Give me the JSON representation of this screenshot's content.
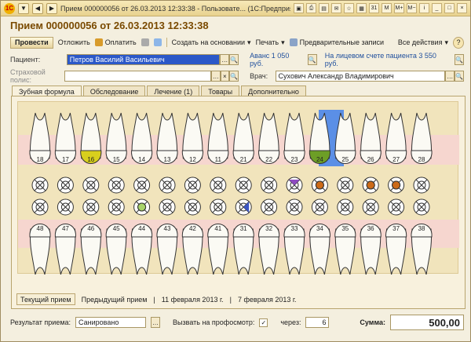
{
  "window": {
    "title": "Прием 000000056 от 26.03.2013 12:33:38 - Пользовате... (1С:Предприятие)"
  },
  "header": {
    "title": "Прием 000000056 от 26.03.2013 12:33:38"
  },
  "toolbar": {
    "post": "Провести",
    "defer": "Отложить",
    "pay": "Оплатить",
    "create_basis": "Создать на основании",
    "print": "Печать",
    "preliminary": "Предварительные записи",
    "all_actions": "Все действия",
    "help": "?"
  },
  "patient": {
    "label": "Пациент:",
    "value": "Петров Василий Васильевич",
    "advance": "Аванс 1 050 руб.",
    "balance": "На лицевом счете пациента 3 550 руб."
  },
  "insurance": {
    "label": "Страховой полис:",
    "value": ""
  },
  "doctor": {
    "label": "Врач:",
    "value": "Сухович Александр Владимирович"
  },
  "tabs": [
    {
      "label": "Зубная формула"
    },
    {
      "label": "Обследование"
    },
    {
      "label": "Лечение (1)"
    },
    {
      "label": "Товары"
    },
    {
      "label": "Дополнительно"
    }
  ],
  "teeth": {
    "upper": [
      "18",
      "17",
      "16",
      "15",
      "14",
      "13",
      "12",
      "11",
      "21",
      "22",
      "23",
      "24",
      "25",
      "26",
      "27",
      "28"
    ],
    "lower": [
      "48",
      "47",
      "46",
      "45",
      "44",
      "43",
      "42",
      "41",
      "31",
      "32",
      "33",
      "34",
      "35",
      "36",
      "37",
      "38"
    ]
  },
  "visits": {
    "current": "Текущий прием",
    "previous": "Предыдущий прием",
    "date1": "11 февраля 2013 г.",
    "date2": "7 февраля 2013 г."
  },
  "footer": {
    "result_label": "Результат приема:",
    "result_value": "Санировано",
    "prophylaxis_label": "Вызвать на профосмотр:",
    "after_label": "через:",
    "after_value": "6",
    "sum_label": "Сумма:",
    "sum_value": "500,00"
  },
  "colors": {
    "accent": "#7a4a00",
    "selected_tooth": "#5b8fe6",
    "yellow_tooth": "#d8cf1d",
    "green_tooth": "#6d9e26",
    "orange_mark": "#cc6a18",
    "purple_mark": "#8e4bc1",
    "blue_mark": "#3a55c4",
    "light_green_mark": "#a8d36a"
  }
}
